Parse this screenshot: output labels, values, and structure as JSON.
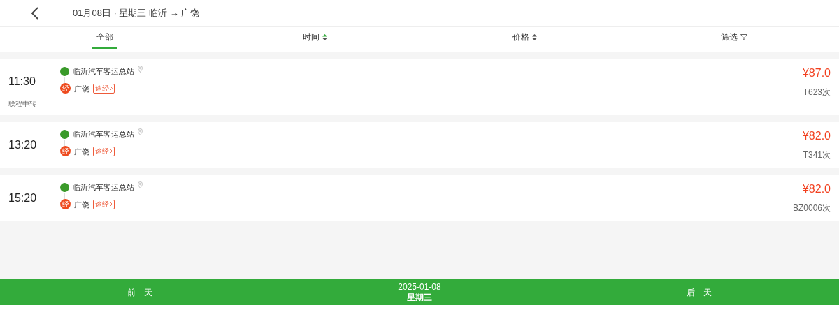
{
  "header": {
    "title": "01月08日 · 星期三 临沂 → 广饶"
  },
  "tabs": [
    {
      "label": "全部",
      "kind": "plain",
      "selected": true
    },
    {
      "label": "时间",
      "kind": "sort",
      "selected": false,
      "active_sort": true
    },
    {
      "label": "价格",
      "kind": "sort",
      "selected": false,
      "active_sort": false
    },
    {
      "label": "筛选",
      "kind": "filter",
      "selected": false
    }
  ],
  "trips": [
    {
      "time": "11:30",
      "note": "联程中转",
      "from": "临沂汽车客运总站",
      "via_badge": "经",
      "to": "广饶",
      "route_tag": "途经",
      "price": "¥87.0",
      "number": "T623次"
    },
    {
      "time": "13:20",
      "from": "临沂汽车客运总站",
      "via_badge": "经",
      "to": "广饶",
      "route_tag": "途经",
      "price": "¥82.0",
      "number": "T341次"
    },
    {
      "time": "15:20",
      "from": "临沂汽车客运总站",
      "via_badge": "经",
      "to": "广饶",
      "route_tag": "途经",
      "price": "¥82.0",
      "number": "BZ0006次"
    }
  ],
  "footer": {
    "prev": "前一天",
    "date": "2025-01-08",
    "weekday": "星期三",
    "next": "后一天"
  }
}
